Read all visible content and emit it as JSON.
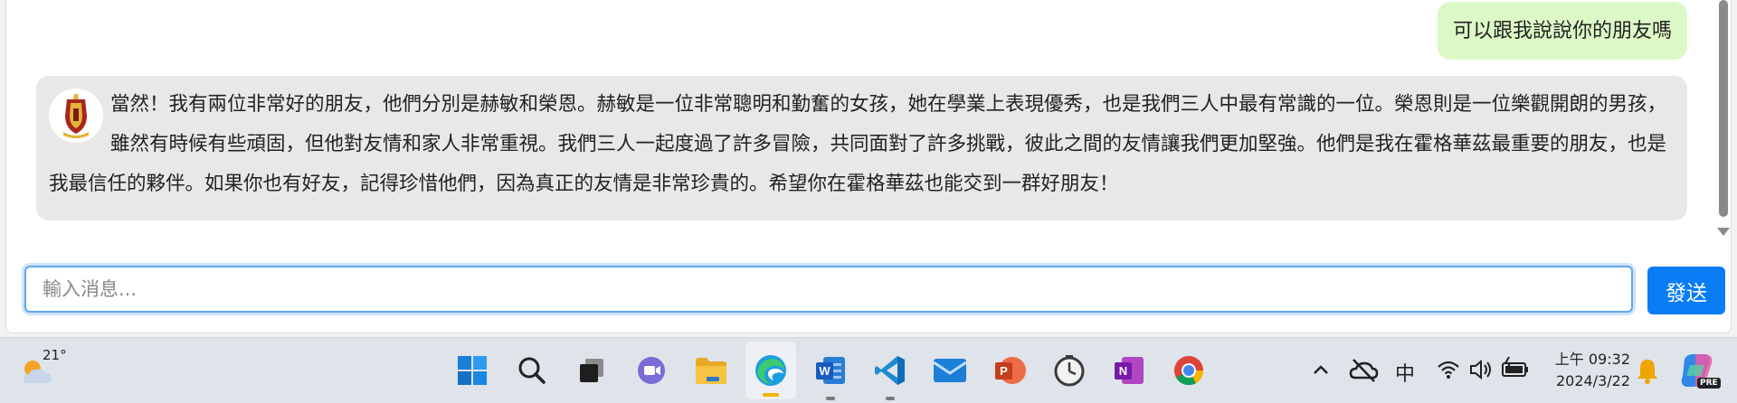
{
  "chat": {
    "user_message": "可以跟我說說你的朋友嗎",
    "bot_message": "當然！我有兩位非常好的朋友，他們分別是赫敏和榮恩。赫敏是一位非常聰明和勤奮的女孩，她在學業上表現優秀，也是我們三人中最有常識的一位。榮恩則是一位樂觀開朗的男孩，雖然有時候有些頑固，但他對友情和家人非常重視。我們三人一起度過了許多冒險，共同面對了許多挑戰，彼此之間的友情讓我們更加堅強。他們是我在霍格華茲最重要的朋友，也是我最信任的夥伴。如果你也有好友，記得珍惜他們，因為真正的友情是非常珍貴的。希望你在霍格華茲也能交到一群好朋友！"
  },
  "input": {
    "placeholder": "輸入消息...",
    "send_label": "發送"
  },
  "taskbar": {
    "weather_temp": "21°",
    "apps": [
      {
        "name": "start-icon",
        "open": false
      },
      {
        "name": "search-icon",
        "open": false
      },
      {
        "name": "task-view-icon",
        "open": false
      },
      {
        "name": "chat-icon",
        "open": false
      },
      {
        "name": "file-explorer-icon",
        "open": false
      },
      {
        "name": "edge-icon",
        "open": true,
        "active": true
      },
      {
        "name": "word-icon",
        "open": true
      },
      {
        "name": "vscode-icon",
        "open": true
      },
      {
        "name": "mail-icon",
        "open": false
      },
      {
        "name": "powerpoint-icon",
        "open": false
      },
      {
        "name": "clock-app-icon",
        "open": false
      },
      {
        "name": "onenote-icon",
        "open": false
      },
      {
        "name": "chrome-icon",
        "open": false
      }
    ],
    "tray": {
      "ime_label": "中",
      "time": "上午 09:32",
      "date": "2024/3/22",
      "copilot_badge": "PRE"
    }
  },
  "colors": {
    "user_bubble": "#dcf8c6",
    "bot_bubble": "#e8e8e8",
    "send_button": "#0a7cf5",
    "input_focus": "#5fa8ef"
  }
}
